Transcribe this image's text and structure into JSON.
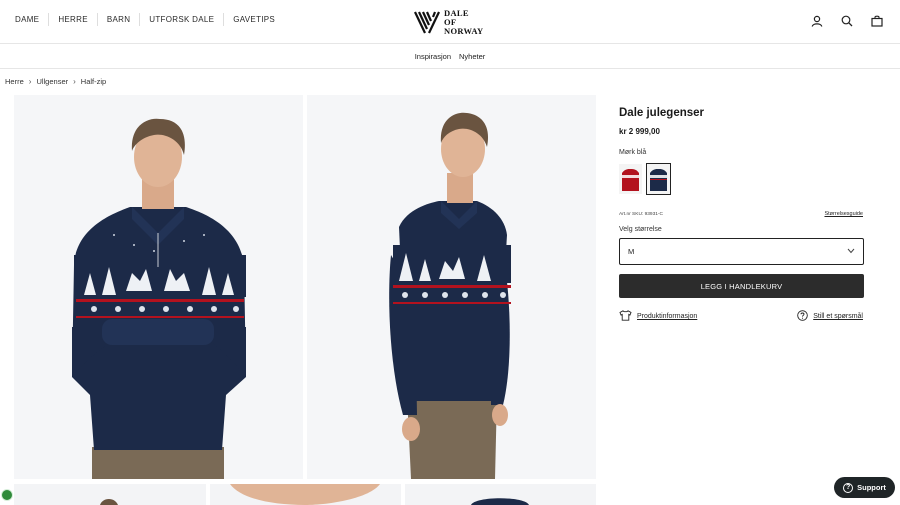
{
  "nav": {
    "items": [
      "DAME",
      "HERRE",
      "BARN",
      "UTFORSK DALE",
      "GAVETIPS"
    ]
  },
  "logo": {
    "line1": "DALE",
    "line2": "OF",
    "line3": "NORWAY"
  },
  "header_icons": [
    "user-icon",
    "search-icon",
    "bag-icon"
  ],
  "subnav": {
    "items": [
      "Inspirasjon",
      "Nyheter"
    ]
  },
  "breadcrumb": [
    "Herre",
    "Ullgenser",
    "Half-zip"
  ],
  "product": {
    "title": "Dale julegenser",
    "price": "kr 2 999,00",
    "color_label": "Mørk blå",
    "swatches": [
      {
        "name": "red",
        "color": "#b3121e"
      },
      {
        "name": "dark-blue",
        "color": "#1c2a48",
        "selected": true
      }
    ],
    "sku": "Art.nr SKU: 93931-C",
    "size_guide": "Størrelsesguide",
    "size_label": "Velg størrelse",
    "size_value": "M",
    "add_to_cart": "LEGG I HANDLEKURV",
    "product_info": "Produktinformasjon",
    "ask_question": "Still et spørsmål"
  },
  "support": {
    "label": "Support"
  },
  "colors": {
    "sweater_navy": "#1c2a48",
    "accent_red": "#b3121e",
    "button_dark": "#2c2c2c",
    "trousers": "#7a6a56",
    "image_bg": "#f5f6f8"
  }
}
